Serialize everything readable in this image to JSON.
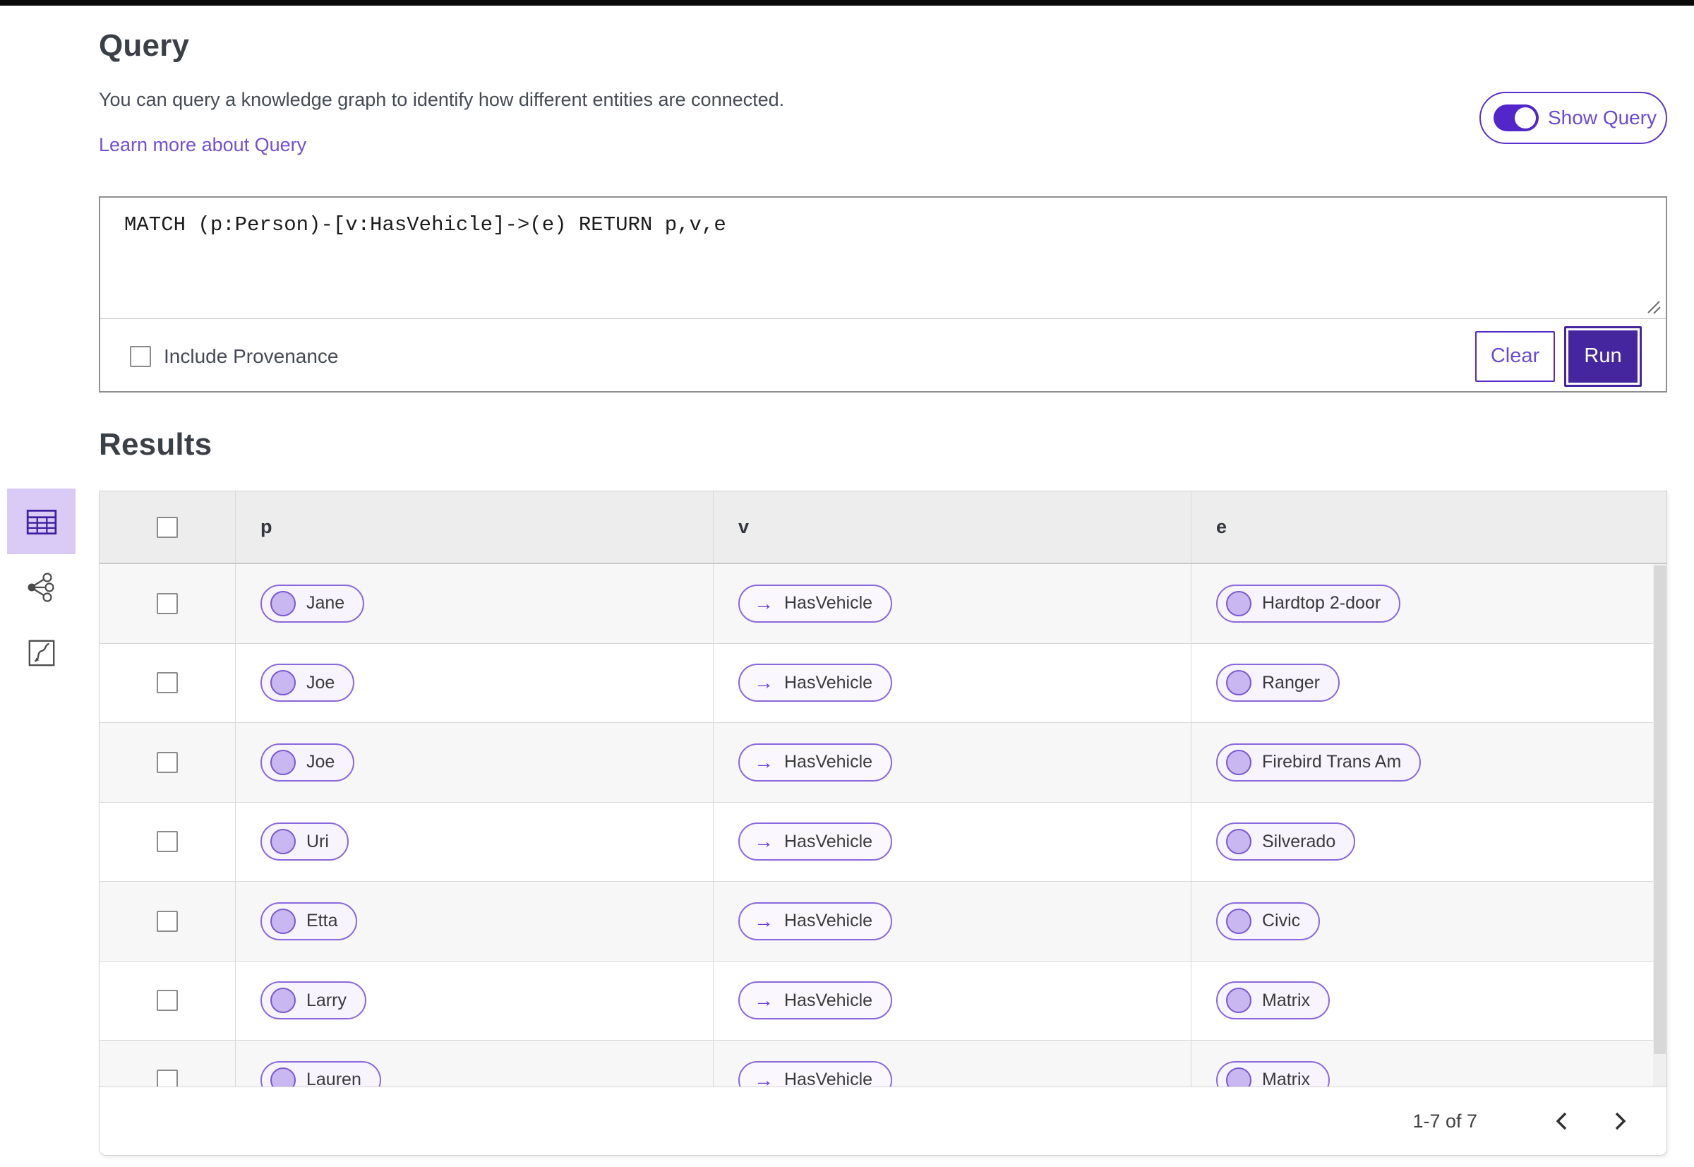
{
  "query_panel": {
    "title": "Query",
    "description": "You can query a knowledge graph to identify how different entities are connected.",
    "learn_more": "Learn more about Query",
    "show_query_label": "Show Query",
    "show_query_on": true,
    "query_text": "MATCH (p:Person)-[v:HasVehicle]->(e) RETURN p,v,e",
    "include_provenance_label": "Include Provenance",
    "include_provenance_checked": false,
    "clear_label": "Clear",
    "run_label": "Run"
  },
  "results_panel": {
    "title": "Results",
    "view_switcher": [
      "table-view",
      "graph-view",
      "chart-view"
    ],
    "selected_view": "table-view",
    "columns": {
      "p": "p",
      "v": "v",
      "e": "e"
    },
    "rows": [
      {
        "p": "Jane",
        "v": "HasVehicle",
        "e": "Hardtop 2-door"
      },
      {
        "p": "Joe",
        "v": "HasVehicle",
        "e": "Ranger"
      },
      {
        "p": "Joe",
        "v": "HasVehicle",
        "e": "Firebird Trans Am"
      },
      {
        "p": "Uri",
        "v": "HasVehicle",
        "e": "Silverado"
      },
      {
        "p": "Etta",
        "v": "HasVehicle",
        "e": "Civic"
      },
      {
        "p": "Larry",
        "v": "HasVehicle",
        "e": "Matrix"
      },
      {
        "p": "Lauren",
        "v": "HasVehicle",
        "e": "Matrix"
      }
    ],
    "pagination": {
      "range_label": "1-7 of 7",
      "prev": "chevron-left",
      "next": "chevron-right"
    }
  },
  "colors": {
    "accent_deep": "#46269e",
    "accent_border": "#5b33cc",
    "link": "#7450d0",
    "pill_border": "#8a68dd",
    "pill_bg": "#f7f4fe",
    "node_fill": "#c8b7f0",
    "node_ring": "#7a57d2",
    "header_bg": "#ededee",
    "alt_row_bg": "#f7f7f8"
  }
}
